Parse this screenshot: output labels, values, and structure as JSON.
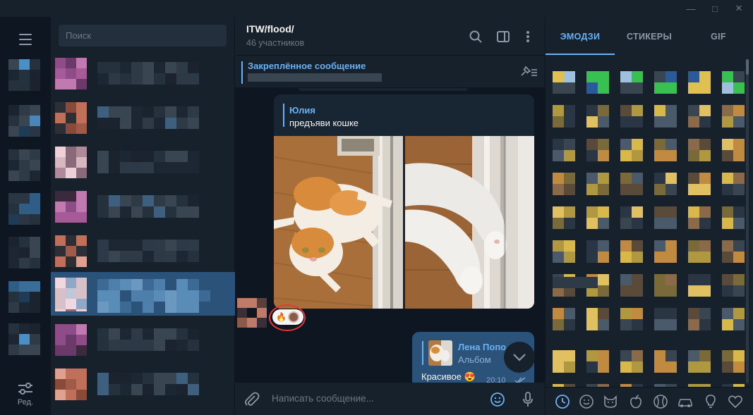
{
  "window": {
    "minimize_icon": "minimize-icon",
    "maximize_icon": "maximize-icon",
    "close_icon": "close-icon"
  },
  "folders": {
    "edit_label": "Ред."
  },
  "chat_list": {
    "search_placeholder": "Поиск"
  },
  "chat": {
    "title": "ITW/flood/",
    "subtitle": "46 участников",
    "pinned": {
      "title": "Закреплённое сообщение"
    },
    "messages": [
      {
        "reply_name": "Юлия",
        "reply_text": "предъяви кошке",
        "reactions": [
          "🔥"
        ]
      },
      {
        "reply_name": "Лена Попо",
        "reply_type": "Альбом",
        "text": "Красивое 😍",
        "time": "20:10"
      }
    ],
    "composer_placeholder": "Написать сообщение..."
  },
  "emoji_panel": {
    "tabs": [
      "ЭМОДЗИ",
      "СТИКЕРЫ",
      "GIF"
    ],
    "active_tab": 0,
    "categories": [
      "recent-icon",
      "smile-icon",
      "cat-icon",
      "apple-icon",
      "ball-icon",
      "car-icon",
      "bulb-icon",
      "heart-icon"
    ]
  },
  "colors": {
    "accent": "#6ab2f2",
    "sidebar": "#17212b",
    "chat_bg": "#0e1621",
    "selected": "#2b5278",
    "annotation": "#e53935"
  }
}
